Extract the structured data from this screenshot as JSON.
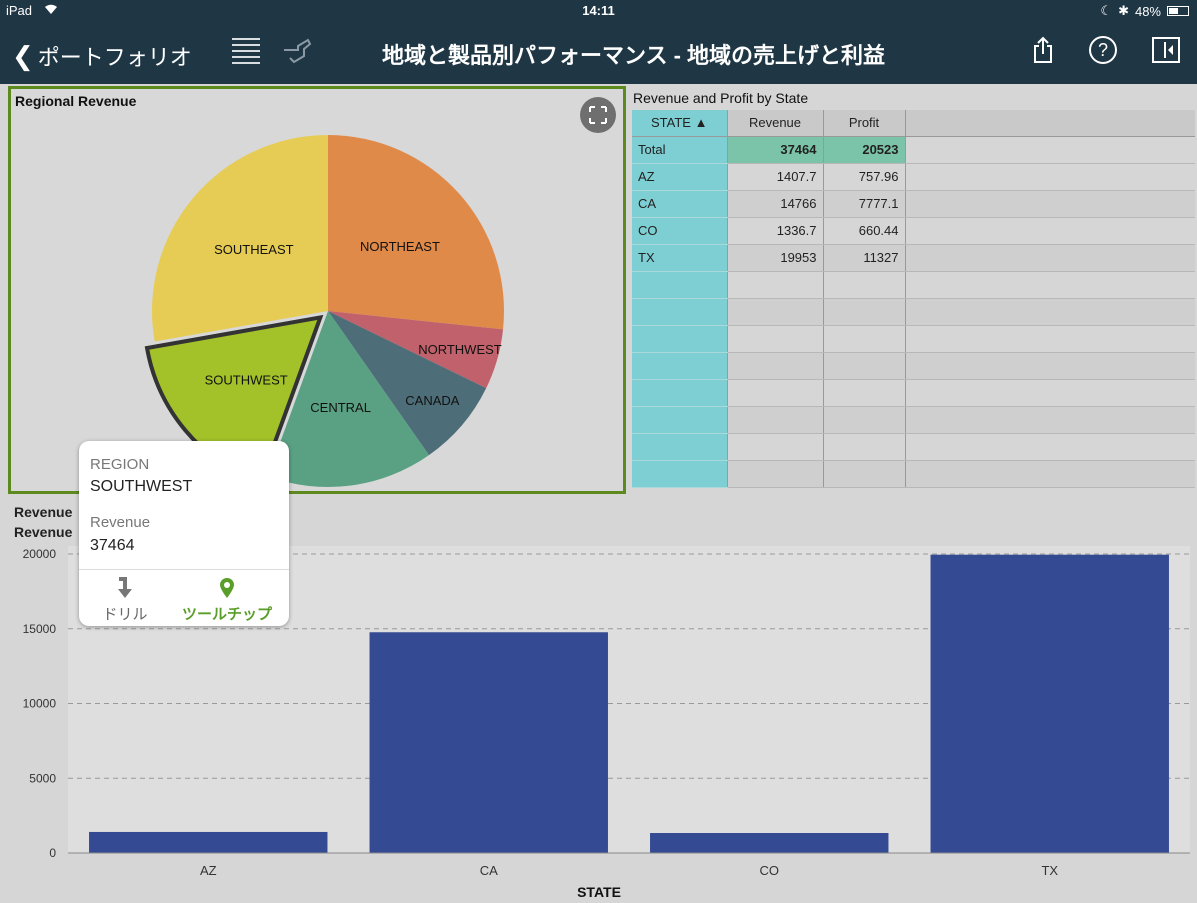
{
  "status_bar": {
    "device": "iPad",
    "time": "14:11",
    "battery": "48%",
    "battery_level": 0.48
  },
  "nav": {
    "back_label": "ポートフォリオ",
    "title": "地域と製品別パフォーマンス - 地域の売上げと利益",
    "help_glyph": "?"
  },
  "pie": {
    "title": "Regional Revenue",
    "chart_data": {
      "type": "pie",
      "slices": [
        {
          "label": "NORTHEAST",
          "start_deg": 0,
          "end_deg": 96,
          "color": "#e08a4a"
        },
        {
          "label": "NORTHWEST",
          "start_deg": 96,
          "end_deg": 116,
          "color": "#c0616b"
        },
        {
          "label": "CANADA",
          "start_deg": 116,
          "end_deg": 145,
          "color": "#4d6e79"
        },
        {
          "label": "CENTRAL",
          "start_deg": 145,
          "end_deg": 200,
          "color": "#5aa184"
        },
        {
          "label": "SOUTHWEST",
          "start_deg": 200,
          "end_deg": 260,
          "color": "#a3c22a",
          "selected": true
        },
        {
          "label": "SOUTHEAST",
          "start_deg": 260,
          "end_deg": 360,
          "color": "#e6cc55"
        }
      ]
    }
  },
  "tooltip": {
    "key1": "REGION",
    "val1": "SOUTHWEST",
    "key2": "Revenue",
    "val2": "37464",
    "drill_label": "ドリル",
    "tooltip_label": "ツールチップ"
  },
  "table": {
    "title": "Revenue and Profit by State",
    "columns": [
      "STATE ▲",
      "Revenue",
      "Profit"
    ],
    "rows": [
      [
        "Total",
        "37464",
        "20523"
      ],
      [
        "AZ",
        "1407.7",
        "757.96"
      ],
      [
        "CA",
        "14766",
        "7777.1"
      ],
      [
        "CO",
        "1336.7",
        "660.44"
      ],
      [
        "TX",
        "19953",
        "11327"
      ]
    ],
    "blank_row_count": 8
  },
  "bar": {
    "label_line1": "Revenue",
    "label_line2": "Revenue",
    "chart_data": {
      "type": "bar",
      "categories": [
        "AZ",
        "CA",
        "CO",
        "TX"
      ],
      "values": [
        1407.7,
        14766,
        1336.7,
        19953
      ],
      "xlabel": "STATE",
      "ylim": [
        0,
        20000
      ],
      "yticks": [
        0,
        5000,
        10000,
        15000,
        20000
      ],
      "grid": true,
      "bar_color": "#344b93"
    }
  },
  "colors": {
    "navbar": "#1f3645",
    "selection_border": "#5c8a1e",
    "state_column": "#7ecfd3",
    "total_highlight": "#7cc4a9"
  }
}
